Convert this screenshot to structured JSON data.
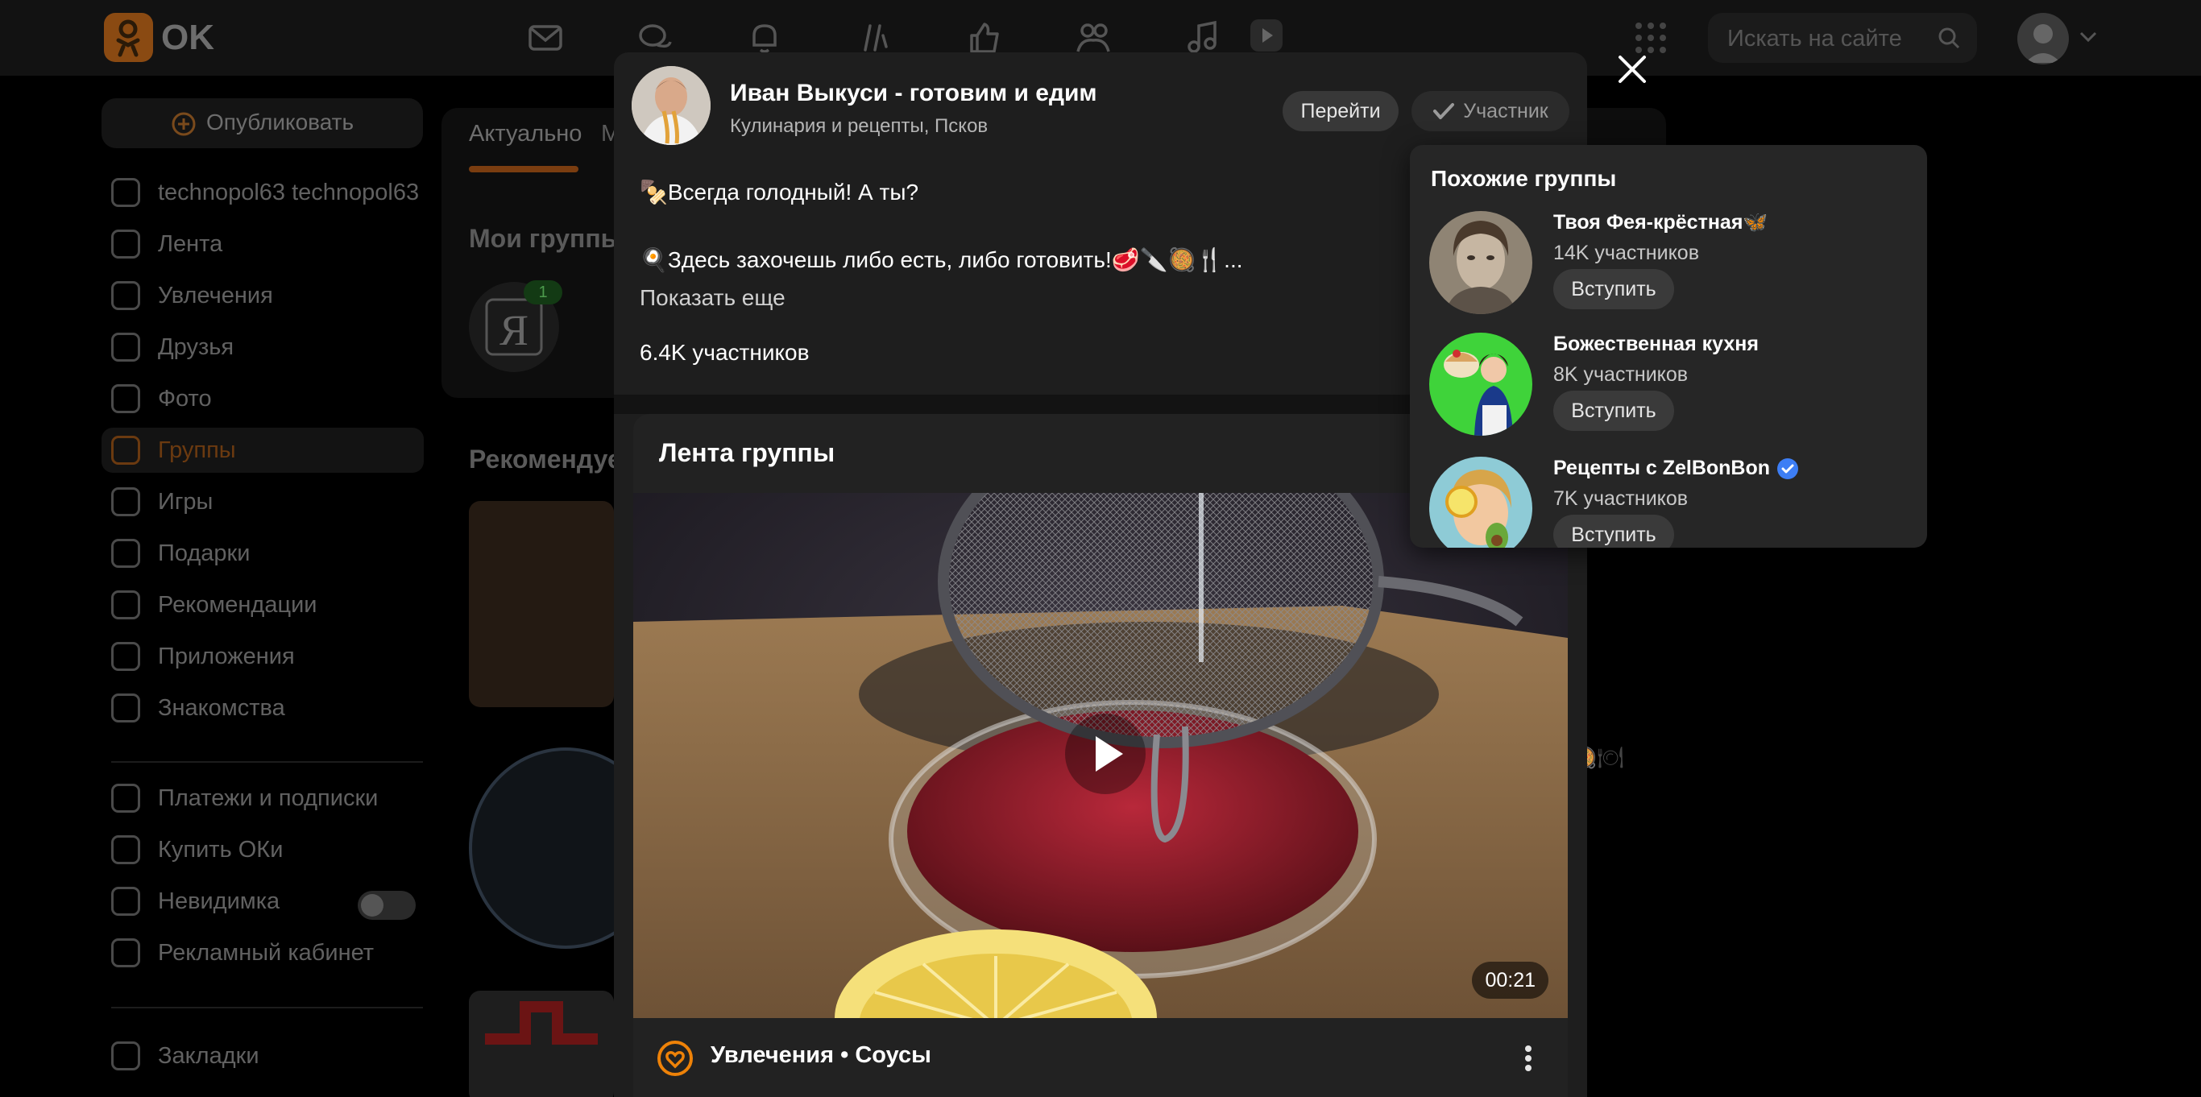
{
  "topbar": {
    "logo_text": "OK",
    "search_placeholder": "Искать на сайте"
  },
  "sidebar": {
    "publish_label": "Опубликовать",
    "items": [
      {
        "label": "technopol63 technopol63"
      },
      {
        "label": "Лента"
      },
      {
        "label": "Увлечения"
      },
      {
        "label": "Друзья"
      },
      {
        "label": "Фото"
      },
      {
        "label": "Группы"
      },
      {
        "label": "Игры"
      },
      {
        "label": "Подарки"
      },
      {
        "label": "Рекомендации"
      },
      {
        "label": "Приложения"
      },
      {
        "label": "Знакомства"
      }
    ],
    "items2": [
      {
        "label": "Платежи и подписки"
      },
      {
        "label": "Купить ОКи"
      },
      {
        "label": "Невидимка"
      },
      {
        "label": "Рекламный кабинет"
      }
    ],
    "bookmarks_label": "Закладки"
  },
  "background": {
    "tab_active": "Актуально",
    "tab_partial": "М",
    "my_groups_heading": "Мои группы",
    "badge_count": "1",
    "recommended_heading": "Рекомендуе"
  },
  "modal": {
    "group_name": "Иван Выкуси - готовим и едим",
    "group_subtitle": "Кулинария и рецепты, Псков",
    "goto_label": "Перейти",
    "member_label": "Участник",
    "desc_line1": "🍢Всегда голодный! А ты?",
    "desc_line2": "🍳Здесь захочешь либо есть, либо готовить!🥩🔪🥘🍴...",
    "show_more": "Показать еще",
    "members_count": "6.4K участников",
    "feed_title": "Лента группы",
    "video_duration": "00:21",
    "post_footer": "Увлечения • Соусы"
  },
  "similar": {
    "title": "Похожие группы",
    "groups": [
      {
        "name": "Твоя Фея-крёстная🦋",
        "count": "14K участников",
        "join_label": "Вступить",
        "verified": false
      },
      {
        "name": "Божественная кухня",
        "count": "8K участников",
        "join_label": "Вступить",
        "verified": false
      },
      {
        "name": "Рецепты с ZelBonBon",
        "count": "7K участников",
        "join_label": "Вступить",
        "verified": true
      }
    ]
  },
  "colors": {
    "ok_orange": "#ee8208",
    "verified_blue": "#3d7ef5",
    "modal_bg": "#1e1e1e"
  },
  "icons": [
    "ok-logo-icon",
    "mail-icon",
    "chat-icon",
    "bell-icon",
    "hobby-icon",
    "like-icon",
    "friends-icon",
    "music-icon",
    "video-icon",
    "apps-grid-icon",
    "search-icon",
    "chevron-down-icon",
    "close-icon",
    "checkmark-icon",
    "play-icon",
    "hobby-orange-icon",
    "kebab-menu-icon",
    "verified-icon"
  ]
}
